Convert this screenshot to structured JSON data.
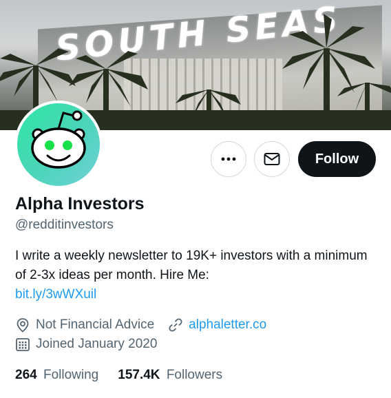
{
  "banner": {
    "sign_text": "SOUTH SEAS"
  },
  "profile": {
    "name": "Alpha Investors",
    "handle": "@redditinvestors",
    "bio_text": "I write a weekly newsletter to 19K+ investors with a minimum of 2-3x ideas per month. Hire Me:",
    "bio_link": "bit.ly/3wWXuil",
    "location": "Not Financial Advice",
    "website": "alphaletter.co",
    "joined": "Joined January 2020"
  },
  "actions": {
    "more_icon": "more-dots-icon",
    "message_icon": "mail-icon",
    "follow_label": "Follow"
  },
  "stats": {
    "following_count": "264",
    "following_label": "Following",
    "followers_count": "157.4K",
    "followers_label": "Followers"
  },
  "colors": {
    "accent": "#1d9bf0",
    "follow_bg": "#0f1419",
    "muted": "#536471",
    "avatar_gradient_start": "#2ee6a3",
    "avatar_gradient_end": "#6fd0d6"
  }
}
